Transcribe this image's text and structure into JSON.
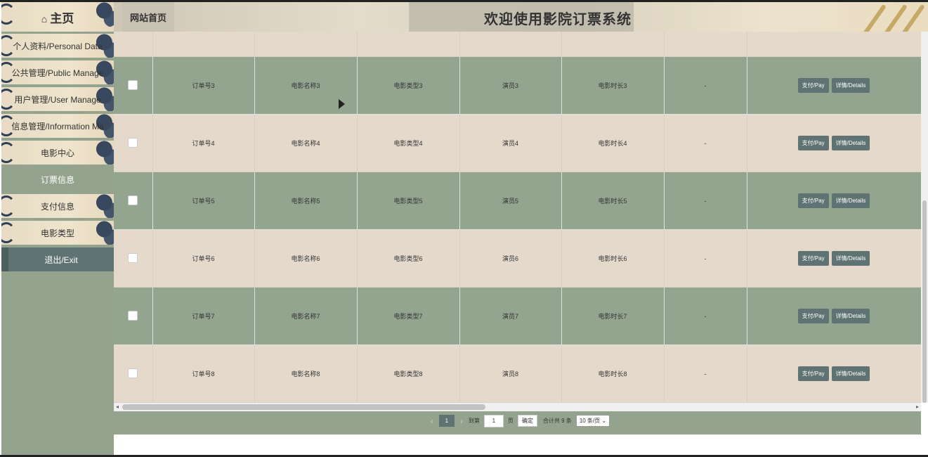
{
  "sidebar": {
    "home": "主页",
    "items": [
      {
        "label": "个人资料/Personal Data"
      },
      {
        "label": "公共管理/Public Manage"
      },
      {
        "label": "用户管理/User Manage"
      },
      {
        "label": "信息管理/Information Ma"
      },
      {
        "label": "电影中心"
      },
      {
        "label": "订票信息"
      },
      {
        "label": "支付信息"
      },
      {
        "label": "电影类型"
      }
    ],
    "exit": "退出/Exit"
  },
  "header": {
    "site_link": "网站首页",
    "title": "欢迎使用影院订票系统"
  },
  "table": {
    "rows": [
      {
        "order": "",
        "movie": "",
        "type": "",
        "actor": "",
        "duration": "",
        "extra": "",
        "pay": "",
        "details": ""
      },
      {
        "order": "订单号3",
        "movie": "电影名称3",
        "type": "电影类型3",
        "actor": "演员3",
        "duration": "电影时长3",
        "extra": "-",
        "pay": "支付/Pay",
        "details": "详情/Details"
      },
      {
        "order": "订单号4",
        "movie": "电影名称4",
        "type": "电影类型4",
        "actor": "演员4",
        "duration": "电影时长4",
        "extra": "-",
        "pay": "支付/Pay",
        "details": "详情/Details"
      },
      {
        "order": "订单号5",
        "movie": "电影名称5",
        "type": "电影类型5",
        "actor": "演员5",
        "duration": "电影时长5",
        "extra": "-",
        "pay": "支付/Pay",
        "details": "详情/Details"
      },
      {
        "order": "订单号6",
        "movie": "电影名称6",
        "type": "电影类型6",
        "actor": "演员6",
        "duration": "电影时长6",
        "extra": "-",
        "pay": "支付/Pay",
        "details": "详情/Details"
      },
      {
        "order": "订单号7",
        "movie": "电影名称7",
        "type": "电影类型7",
        "actor": "演员7",
        "duration": "电影时长7",
        "extra": "-",
        "pay": "支付/Pay",
        "details": "详情/Details"
      },
      {
        "order": "订单号8",
        "movie": "电影名称8",
        "type": "电影类型8",
        "actor": "演员8",
        "duration": "电影时长8",
        "extra": "-",
        "pay": "支付/Pay",
        "details": "详情/Details"
      }
    ]
  },
  "pager": {
    "current": "1",
    "goto_label": "到第",
    "goto_value": "1",
    "page_unit": "页",
    "confirm": "确定",
    "total": "合计共 9 条",
    "page_size": "10 条/页"
  },
  "colors": {
    "sidebar_bg": "#93a38d",
    "row_dark": "#93a48f",
    "row_light": "#e4d9cb",
    "button": "#5f7472"
  }
}
